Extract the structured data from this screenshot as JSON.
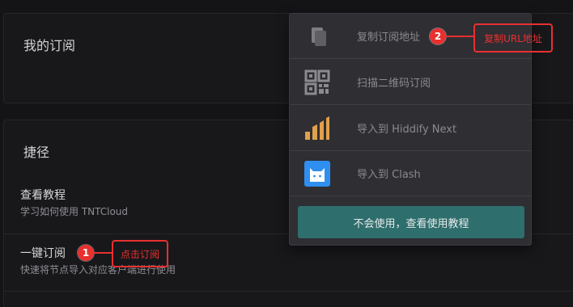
{
  "subscriptions": {
    "title": "我的订阅"
  },
  "shortcuts": {
    "title": "捷径",
    "items": [
      {
        "title": "查看教程",
        "desc": "学习如何使用 TNTCloud"
      },
      {
        "title": "一键订阅",
        "desc": "快速将节点导入对应客户端进行使用"
      },
      {
        "title": ""
      }
    ]
  },
  "dropdown": {
    "items": [
      {
        "icon": "copy-icon",
        "label": "复制订阅地址"
      },
      {
        "icon": "qr-code-icon",
        "label": "扫描二维码订阅"
      },
      {
        "icon": "hiddify-icon",
        "label": "导入到 Hiddify Next"
      },
      {
        "icon": "clash-cat-icon",
        "label": "导入到 Clash"
      }
    ],
    "button_label": "不会使用，查看使用教程"
  },
  "annotations": [
    {
      "number": "1",
      "text": "点击订阅"
    },
    {
      "number": "2",
      "text": "复制URL地址"
    }
  ],
  "colors": {
    "accent_button": "#2e6f6e",
    "annotation_red": "#e8302f",
    "hiddify_orange": "#e0a04a",
    "clash_blue": "#2f8ff0"
  }
}
